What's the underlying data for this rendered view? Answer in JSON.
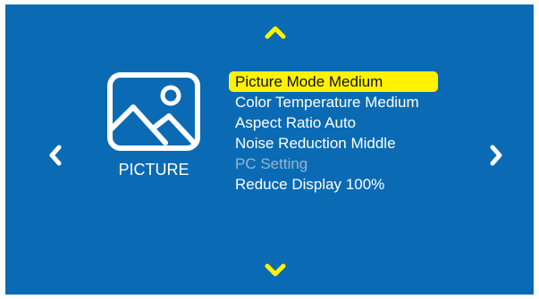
{
  "colors": {
    "background": "#0a6bb4",
    "accent": "#fff200",
    "text": "#ffffff",
    "disabled_text": "#9ab4cc"
  },
  "navigation": {
    "up_icon": "chevron-up-icon",
    "down_icon": "chevron-down-icon",
    "left_icon": "chevron-left-icon",
    "right_icon": "chevron-right-icon"
  },
  "category": {
    "icon": "picture-icon",
    "label": "PICTURE"
  },
  "menu": {
    "items": [
      {
        "label": "Picture Mode Medium",
        "state": "selected"
      },
      {
        "label": "Color Temperature Medium",
        "state": "normal"
      },
      {
        "label": "Aspect Ratio Auto",
        "state": "normal"
      },
      {
        "label": "Noise Reduction Middle",
        "state": "normal"
      },
      {
        "label": "PC Setting",
        "state": "disabled"
      },
      {
        "label": "Reduce Display 100%",
        "state": "normal"
      }
    ]
  }
}
